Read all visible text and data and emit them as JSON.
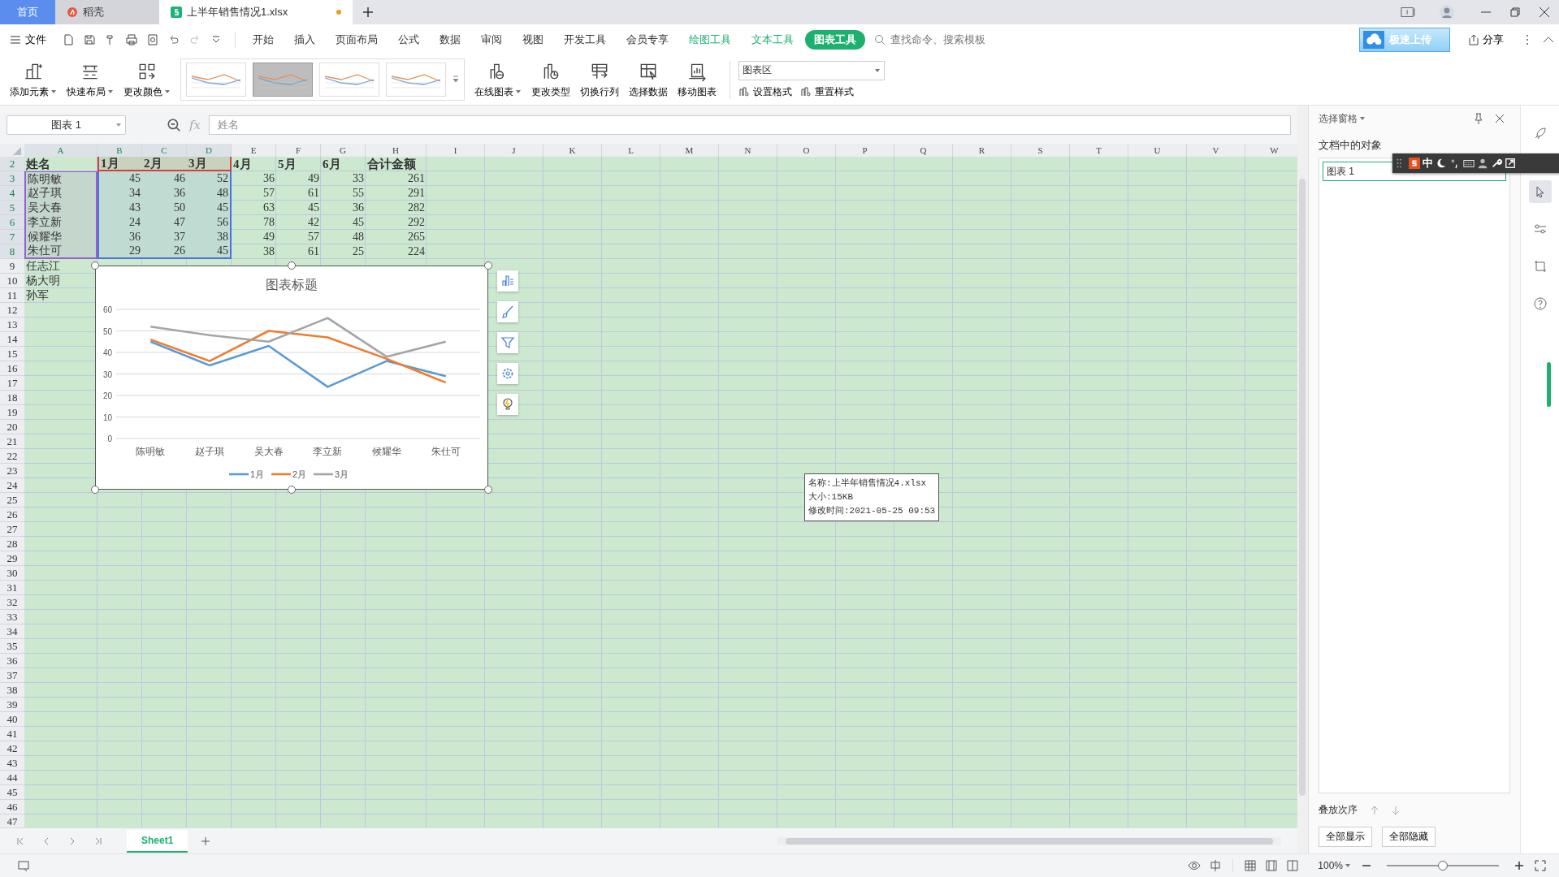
{
  "title_tabs": [
    {
      "label": "首页",
      "kind": "home",
      "selected": false,
      "unsaved": false
    },
    {
      "label": "稻壳",
      "kind": "docer",
      "selected": false,
      "unsaved": false
    },
    {
      "label": "上半年销售情况1.xlsx",
      "kind": "sheet",
      "selected": true,
      "unsaved": true
    }
  ],
  "menu": {
    "file": "文件",
    "tabs": [
      {
        "label": "开始",
        "kind": "main",
        "selected": false
      },
      {
        "label": "插入",
        "kind": "main",
        "selected": false
      },
      {
        "label": "页面布局",
        "kind": "main",
        "selected": false
      },
      {
        "label": "公式",
        "kind": "main",
        "selected": false
      },
      {
        "label": "数据",
        "kind": "main",
        "selected": false
      },
      {
        "label": "审阅",
        "kind": "main",
        "selected": false
      },
      {
        "label": "视图",
        "kind": "main",
        "selected": false
      },
      {
        "label": "开发工具",
        "kind": "main",
        "selected": false
      },
      {
        "label": "会员专享",
        "kind": "main",
        "selected": false
      },
      {
        "label": "绘图工具",
        "kind": "context",
        "selected": false
      },
      {
        "label": "文本工具",
        "kind": "context",
        "selected": false
      },
      {
        "label": "图表工具",
        "kind": "context",
        "selected": true
      }
    ],
    "search": {
      "placeholder": "查找命令、搜索模板"
    },
    "upload": "极速上传",
    "share": "分享"
  },
  "ribbon": {
    "buttons_left": [
      {
        "label": "添加元素",
        "dropdown": true
      },
      {
        "label": "快速布局",
        "dropdown": true
      },
      {
        "label": "更改颜色",
        "dropdown": true
      }
    ],
    "styles": [
      {
        "selected": false
      },
      {
        "selected": true
      },
      {
        "selected": false
      },
      {
        "selected": false
      }
    ],
    "buttons_right": [
      {
        "label": "在线图表",
        "dropdown": true
      },
      {
        "label": "更改类型",
        "dropdown": false
      },
      {
        "label": "切换行列",
        "dropdown": false
      },
      {
        "label": "选择数据",
        "dropdown": false
      },
      {
        "label": "移动图表",
        "dropdown": false
      }
    ],
    "element_select": "图表区",
    "small_buttons": [
      "设置格式",
      "重置样式"
    ]
  },
  "formula_bar": {
    "name_box": "图表 1",
    "fx": "fx",
    "value": "姓名"
  },
  "sheet": {
    "columns": [
      {
        "label": "A",
        "in_chart": true
      },
      {
        "label": "B",
        "in_chart": true
      },
      {
        "label": "C",
        "in_chart": true
      },
      {
        "label": "D",
        "in_chart": true
      },
      {
        "label": "E",
        "in_chart": false
      },
      {
        "label": "F",
        "in_chart": false
      },
      {
        "label": "G",
        "in_chart": false
      },
      {
        "label": "H",
        "in_chart": false
      },
      {
        "label": "I",
        "in_chart": false
      },
      {
        "label": "J",
        "in_chart": false
      },
      {
        "label": "K",
        "in_chart": false
      },
      {
        "label": "L",
        "in_chart": false
      },
      {
        "label": "M",
        "in_chart": false
      },
      {
        "label": "N",
        "in_chart": false
      },
      {
        "label": "O",
        "in_chart": false
      },
      {
        "label": "P",
        "in_chart": false
      },
      {
        "label": "Q",
        "in_chart": false
      },
      {
        "label": "R",
        "in_chart": false
      },
      {
        "label": "S",
        "in_chart": false
      },
      {
        "label": "T",
        "in_chart": false
      },
      {
        "label": "U",
        "in_chart": false
      },
      {
        "label": "V",
        "in_chart": false
      },
      {
        "label": "W",
        "in_chart": false
      }
    ],
    "rows": [
      {
        "num": "2",
        "kind": "header",
        "in_chart": true,
        "cells": [
          "姓名",
          "1月",
          "2月",
          "3月",
          "4月",
          "5月",
          "6月",
          "合计金额"
        ]
      },
      {
        "num": "3",
        "kind": "data",
        "in_chart": true,
        "cells": [
          "陈明敏",
          "45",
          "46",
          "52",
          "36",
          "49",
          "33",
          "261"
        ]
      },
      {
        "num": "4",
        "kind": "data",
        "in_chart": true,
        "cells": [
          "赵子琪",
          "34",
          "36",
          "48",
          "57",
          "61",
          "55",
          "291"
        ]
      },
      {
        "num": "5",
        "kind": "data",
        "in_chart": true,
        "cells": [
          "吴大春",
          "43",
          "50",
          "45",
          "63",
          "45",
          "36",
          "282"
        ]
      },
      {
        "num": "6",
        "kind": "data",
        "in_chart": true,
        "cells": [
          "李立新",
          "24",
          "47",
          "56",
          "78",
          "42",
          "45",
          "292"
        ]
      },
      {
        "num": "7",
        "kind": "data",
        "in_chart": true,
        "cells": [
          "候耀华",
          "36",
          "37",
          "38",
          "49",
          "57",
          "48",
          "265"
        ]
      },
      {
        "num": "8",
        "kind": "data",
        "in_chart": true,
        "cells": [
          "朱仕可",
          "29",
          "26",
          "45",
          "38",
          "61",
          "25",
          "224"
        ]
      },
      {
        "num": "9",
        "kind": "data",
        "in_chart": false,
        "cells": [
          "任志江"
        ]
      },
      {
        "num": "10",
        "kind": "data",
        "in_chart": false,
        "cells": [
          "杨大明"
        ]
      },
      {
        "num": "11",
        "kind": "data",
        "in_chart": false,
        "cells": [
          "孙军"
        ]
      },
      {
        "num": "12"
      },
      {
        "num": "13"
      },
      {
        "num": "14"
      },
      {
        "num": "15"
      },
      {
        "num": "16"
      },
      {
        "num": "17"
      },
      {
        "num": "18"
      },
      {
        "num": "19"
      },
      {
        "num": "20"
      },
      {
        "num": "21"
      },
      {
        "num": "22"
      },
      {
        "num": "23"
      },
      {
        "num": "24"
      },
      {
        "num": "25"
      },
      {
        "num": "26"
      },
      {
        "num": "27"
      },
      {
        "num": "28"
      },
      {
        "num": "29"
      },
      {
        "num": "30"
      },
      {
        "num": "31"
      },
      {
        "num": "32"
      },
      {
        "num": "33"
      },
      {
        "num": "34"
      },
      {
        "num": "35"
      },
      {
        "num": "36"
      },
      {
        "num": "37"
      },
      {
        "num": "38"
      },
      {
        "num": "39"
      },
      {
        "num": "40"
      },
      {
        "num": "41"
      },
      {
        "num": "42"
      },
      {
        "num": "43"
      },
      {
        "num": "44"
      },
      {
        "num": "45"
      },
      {
        "num": "46"
      },
      {
        "num": "47"
      }
    ]
  },
  "chart": {
    "chart_data": {
      "type": "line",
      "title": "图表标题",
      "categories": [
        "陈明敏",
        "赵子琪",
        "吴大春",
        "李立新",
        "候耀华",
        "朱仕可"
      ],
      "series": [
        {
          "name": "1月",
          "color": "#5b9bd5",
          "values": [
            45,
            34,
            43,
            24,
            36,
            29
          ]
        },
        {
          "name": "2月",
          "color": "#ed7d31",
          "values": [
            46,
            36,
            50,
            47,
            37,
            26
          ]
        },
        {
          "name": "3月",
          "color": "#a5a5a5",
          "values": [
            52,
            48,
            45,
            56,
            38,
            45
          ]
        }
      ],
      "ylim": [
        0,
        60
      ],
      "yticks": [
        0,
        10,
        20,
        30,
        40,
        50,
        60
      ],
      "grid": true,
      "legend": "bottom"
    }
  },
  "tooltip": {
    "lines": [
      "名称:上半年销售情况4.xlsx",
      "大小:15KB",
      "修改时间:2021-05-25 09:53"
    ]
  },
  "pane": {
    "title": "选择窗格",
    "heading": "文档中的对象",
    "objects": [
      {
        "label": "图表 1",
        "selected": true
      }
    ],
    "order_label": "叠放次序",
    "buttons": [
      "全部显示",
      "全部隐藏"
    ]
  },
  "ime_bar": {
    "mode": "中"
  },
  "sheet_tabs": [
    {
      "label": "Sheet1",
      "selected": true
    }
  ],
  "status": {
    "zoom": "100%",
    "level": 0.5
  }
}
